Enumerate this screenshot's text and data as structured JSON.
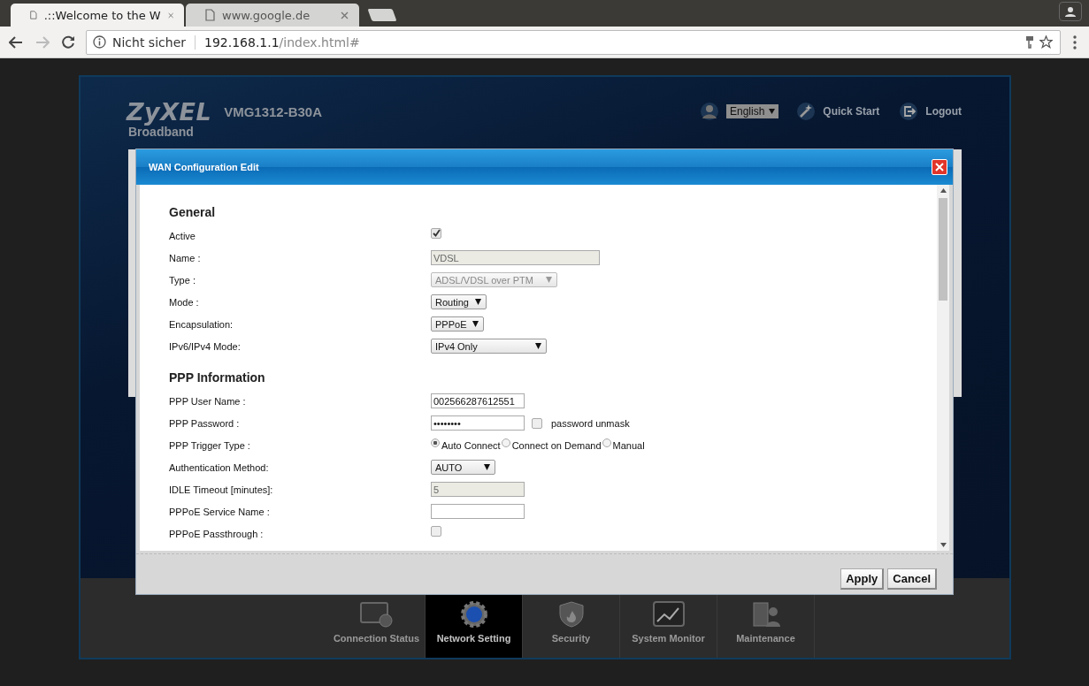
{
  "browser": {
    "tabs": [
      {
        "title": ".::Welcome to the W",
        "selected": true
      },
      {
        "title": "www.google.de",
        "selected": false
      }
    ],
    "address": {
      "security": "Nicht sicher",
      "host": "192.168.1.1",
      "path": "/index.html#"
    }
  },
  "router": {
    "brand": "ZyXEL",
    "model": "VMG1312-B30A",
    "language": "English",
    "quick_start": "Quick Start",
    "logout": "Logout",
    "page_title": "Broadband"
  },
  "dialog": {
    "title": "WAN Configuration Edit",
    "sections": [
      {
        "heading": "General",
        "fields": [
          {
            "label": "Active",
            "kind": "checkbox",
            "checked": true
          },
          {
            "label": "Name :",
            "kind": "text",
            "value": "VDSL",
            "disabled": true
          },
          {
            "label": "Type :",
            "kind": "select",
            "value": "ADSL/VDSL over PTM",
            "disabled": true
          },
          {
            "label": "Mode :",
            "kind": "select",
            "value": "Routing",
            "disabled": false
          },
          {
            "label": "Encapsulation:",
            "kind": "select",
            "value": "PPPoE",
            "disabled": false
          },
          {
            "label": "IPv6/IPv4 Mode:",
            "kind": "select",
            "value": "IPv4 Only",
            "disabled": false
          }
        ]
      },
      {
        "heading": "PPP Information",
        "fields": [
          {
            "label": "PPP User Name :",
            "kind": "text",
            "value": "002566287612551",
            "disabled": false
          },
          {
            "label": "PPP Password :",
            "kind": "password",
            "value": "••••••••",
            "unmask": {
              "label": "password unmask",
              "checked": false
            }
          },
          {
            "label": "PPP Trigger Type :",
            "kind": "radio",
            "options": [
              {
                "label": "Auto Connect",
                "selected": true
              },
              {
                "label": "Connect on Demand",
                "selected": false
              },
              {
                "label": "Manual",
                "selected": false
              }
            ]
          },
          {
            "label": "Authentication Method:",
            "kind": "select",
            "value": "AUTO",
            "disabled": false
          },
          {
            "label": "IDLE Timeout [minutes]:",
            "kind": "text",
            "value": "5",
            "disabled": true
          },
          {
            "label": "PPPoE Service Name :",
            "kind": "text",
            "disabled": false
          },
          {
            "label": "PPPoE Passthrough :",
            "kind": "checkbox",
            "checked": false
          }
        ]
      }
    ],
    "buttons": [
      "Apply",
      "Cancel"
    ]
  },
  "nav": [
    {
      "label": "Connection Status",
      "selected": false
    },
    {
      "label": "Network Setting",
      "selected": true
    },
    {
      "label": "Security",
      "selected": false
    },
    {
      "label": "System Monitor",
      "selected": false
    },
    {
      "label": "Maintenance",
      "selected": false
    }
  ]
}
